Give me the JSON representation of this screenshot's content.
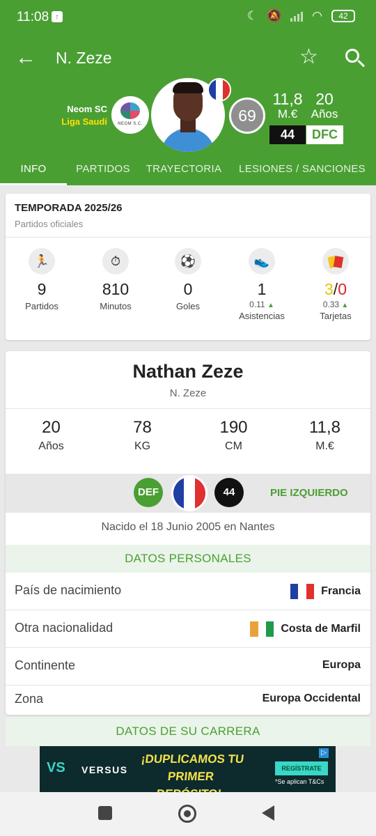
{
  "status_bar": {
    "time": "11:08",
    "battery": "42"
  },
  "header": {
    "title": "N. Zeze"
  },
  "club": {
    "name": "Neom SC",
    "league": "Liga Saudí",
    "logo_text": "NEOM S.C."
  },
  "player_header": {
    "rating": "69",
    "value": "11,8",
    "value_unit": "M.€",
    "age": "20",
    "age_unit": "Años",
    "number": "44",
    "position": "DFC"
  },
  "tabs": [
    "INFO",
    "PARTIDOS",
    "TRAYECTORIA",
    "LESIONES / SANCIONES"
  ],
  "season": {
    "title": "TEMPORADA 2025/26",
    "subtitle": "Partidos oficiales",
    "stats": [
      {
        "icon": "running-player-icon",
        "value": "9",
        "label": "Partidos"
      },
      {
        "icon": "stopwatch-icon",
        "value": "810",
        "label": "Minutos"
      },
      {
        "icon": "ball-icon",
        "value": "0",
        "label": "Goles"
      },
      {
        "icon": "boot-icon",
        "value": "1",
        "sub": "0.11",
        "label": "Asistencias"
      },
      {
        "icon": "cards-icon",
        "yellow": "3",
        "separator": "/",
        "red": "0",
        "sub": "0.33",
        "label": "Tarjetas"
      }
    ]
  },
  "profile": {
    "full_name": "Nathan Zeze",
    "short_name": "N. Zeze",
    "bio": [
      {
        "value": "20",
        "unit": "Años"
      },
      {
        "value": "78",
        "unit": "KG"
      },
      {
        "value": "190",
        "unit": "CM"
      },
      {
        "value": "11,8",
        "unit": "M.€"
      }
    ],
    "position_badge": "DEF",
    "number_badge": "44",
    "foot": "PIE IZQUIERDO",
    "born": "Nacido el 18 Junio 2005 en Nantes"
  },
  "personal": {
    "heading": "DATOS PERSONALES",
    "rows": [
      {
        "key": "País de nacimiento",
        "value": "Francia"
      },
      {
        "key": "Otra nacionalidad",
        "value": "Costa de Marfil"
      },
      {
        "key": "Continente",
        "value": "Europa"
      },
      {
        "key": "Zona",
        "value": "Europa Occidental"
      }
    ]
  },
  "career": {
    "heading": "DATOS DE SU CARRERA"
  },
  "ad": {
    "brand": "VERSUS",
    "headline_1": "¡DUPLICAMOS TU",
    "headline_2": "PRIMER DEPÓSITO!",
    "cta": "REGÍSTRATE",
    "terms": "*Se aplican T&Cs"
  },
  "colors": {
    "primary_green": "#4a9f33",
    "header_bg": "#4a9f33",
    "yellow_accent": "#ffe100",
    "red_card": "#d8262e"
  }
}
